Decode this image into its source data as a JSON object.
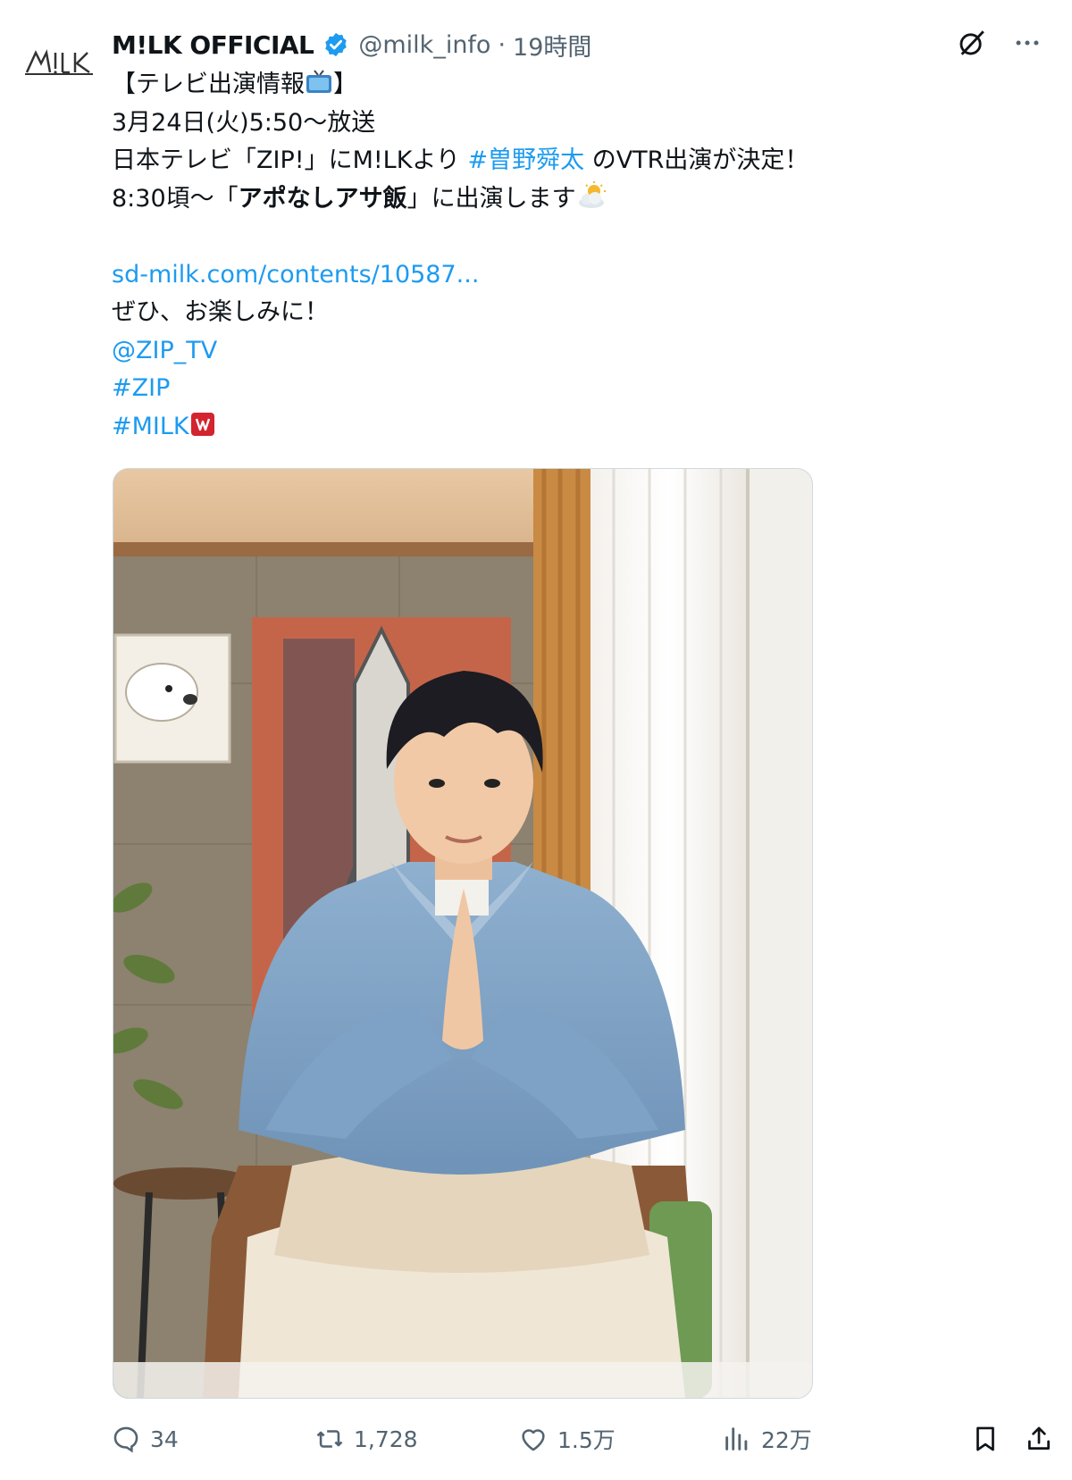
{
  "post": {
    "avatar_text": "M!LK",
    "author_name": "M!LK OFFICIAL",
    "handle": "@milk_info",
    "separator": "·",
    "time": "19時間",
    "lines": {
      "l1": "【テレビ出演情報",
      "l1_end": "】",
      "l2": "3月24日(火)5:50〜放送",
      "l3a": "日本テレビ「ZIP!」にM!LKより ",
      "l3_tag": "#曽野舜太",
      "l3b": " のVTR出演が決定！",
      "l4a": "8:30頃〜「",
      "l4_bold": "アポなしアサ飯",
      "l4b": "」に出演します",
      "link": "sd-milk.com/contents/10587...",
      "l6": "ぜひ、お楽しみに！",
      "mention": "@ZIP_TV",
      "tag_zip": "#ZIP",
      "tag_milk": "#MILK"
    },
    "stats": {
      "replies": "34",
      "reposts": "1,728",
      "likes": "1.5万",
      "views": "22万"
    },
    "icons": {
      "verified": "verified-badge-icon",
      "grok": "grok-icon",
      "more": "more-icon",
      "reply": "reply-icon",
      "repost": "repost-icon",
      "like": "heart-icon",
      "views": "views-icon",
      "bookmark": "bookmark-icon",
      "share": "share-icon"
    },
    "colors": {
      "link": "#1d9bf0",
      "verified": "#1d9bf0",
      "muted": "#536471"
    }
  }
}
